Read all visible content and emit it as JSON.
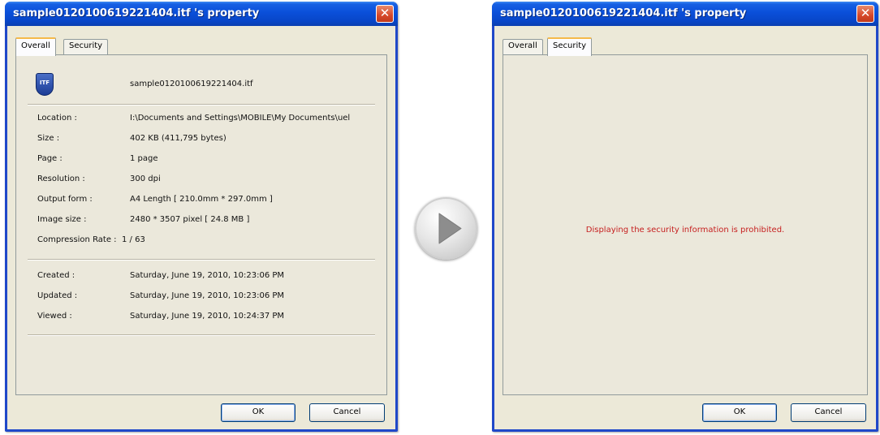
{
  "left_window": {
    "title": "sample0120100619221404.itf 's property",
    "close_glyph": "✕",
    "tabs": [
      {
        "label": "Overall",
        "active": true
      },
      {
        "label": "Security",
        "active": false
      }
    ],
    "file_icon": {
      "name": "itf-file-icon",
      "text": "ITF"
    },
    "file_name": "sample0120100619221404.itf",
    "properties": [
      {
        "label": "Location :",
        "value": "I:\\Documents and Settings\\MOBILE\\My Documents\\uel"
      },
      {
        "label": "Size :",
        "value": "402 KB (411,795 bytes)"
      },
      {
        "label": "Page :",
        "value": "1 page"
      },
      {
        "label": "Resolution :",
        "value": "300 dpi"
      },
      {
        "label": "Output form :",
        "value": "A4 Length [ 210.0mm * 297.0mm ]"
      },
      {
        "label": "Image size :",
        "value": "2480 * 3507 pixel [ 24.8 MB ]"
      },
      {
        "label": "Compression Rate :",
        "value": "1 / 63"
      }
    ],
    "dates": [
      {
        "label": "Created :",
        "value": "Saturday, June 19, 2010, 10:23:06 PM"
      },
      {
        "label": "Updated :",
        "value": "Saturday, June 19, 2010, 10:23:06 PM"
      },
      {
        "label": "Viewed :",
        "value": "Saturday, June 19, 2010, 10:24:37 PM"
      }
    ],
    "ok_label": "OK",
    "cancel_label": "Cancel"
  },
  "arrow": {
    "icon": "play-arrow-icon"
  },
  "right_window": {
    "title": "sample0120100619221404.itf 's property",
    "close_glyph": "✕",
    "tabs": [
      {
        "label": "Overall",
        "active": false
      },
      {
        "label": "Security",
        "active": true
      }
    ],
    "message": "Displaying the security information is prohibited.",
    "ok_label": "OK",
    "cancel_label": "Cancel"
  },
  "colors": {
    "titlebar": "#0a4fd9",
    "close_button": "#d6482a",
    "dialog_background": "#ece9d8",
    "active_tab_accent": "#f5b94a",
    "error_message": "#c62020"
  }
}
